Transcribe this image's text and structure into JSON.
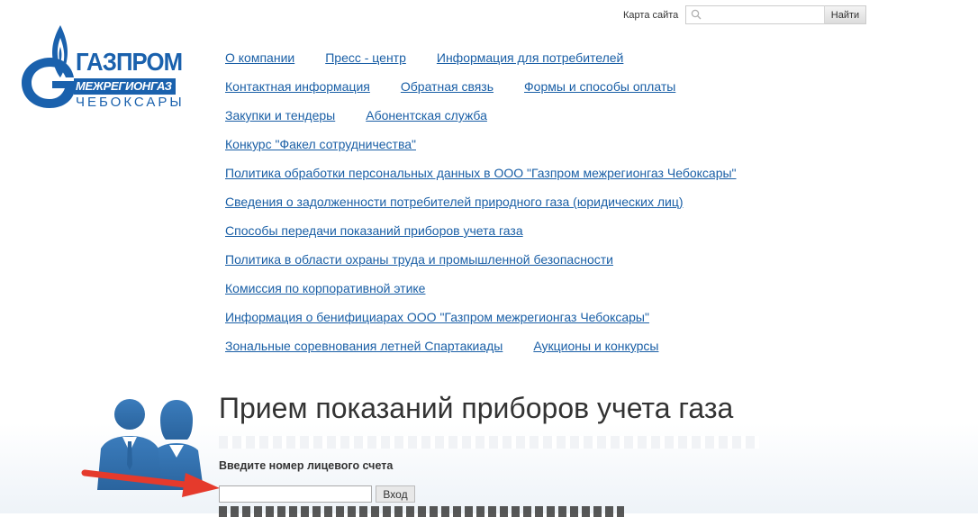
{
  "header": {
    "sitemap_label": "Карта сайта",
    "search": {
      "value": "",
      "placeholder": ""
    },
    "search_button_label": "Найти"
  },
  "logo": {
    "line1": "ГАЗПРОМ",
    "line2": "МЕЖРЕГИОНГАЗ",
    "line3": "ЧЕБОКСАРЫ",
    "brand_color": "#1a61ad"
  },
  "nav": {
    "rows": [
      [
        "О компании",
        "Пресс - центр",
        "Информация для потребителей"
      ],
      [
        "Контактная информация",
        "Обратная связь",
        "Формы и способы оплаты"
      ],
      [
        "Закупки и тендеры",
        "Абонентская служба"
      ],
      [
        "Конкурс \"Факел сотрудничества\""
      ],
      [
        "Политика обработки персональных данных в ООО \"Газпром межрегионгаз Чебоксары\""
      ],
      [
        "Сведения о задолженности потребителей природного газа (юридических лиц)"
      ],
      [
        "Способы передачи показаний приборов учета газа"
      ],
      [
        "Политика в области охраны труда и промышленной безопасности"
      ],
      [
        "Комиссия по корпоративной этике"
      ],
      [
        "Информация о бенифициарах ООО \"Газпром межрегионгаз Чебоксары\""
      ],
      [
        "Зональные соревнования летней Спартакиады",
        "Аукционы и конкурсы"
      ]
    ],
    "link_color": "#1a5fa6"
  },
  "main": {
    "title": "Прием показаний приборов учета газа",
    "account_label": "Введите номер лицевого счета",
    "account_input": {
      "value": "",
      "placeholder": ""
    },
    "login_button_label": "Вход",
    "arrow_color": "#e53a2c",
    "icon_color": "#2f6fae"
  }
}
